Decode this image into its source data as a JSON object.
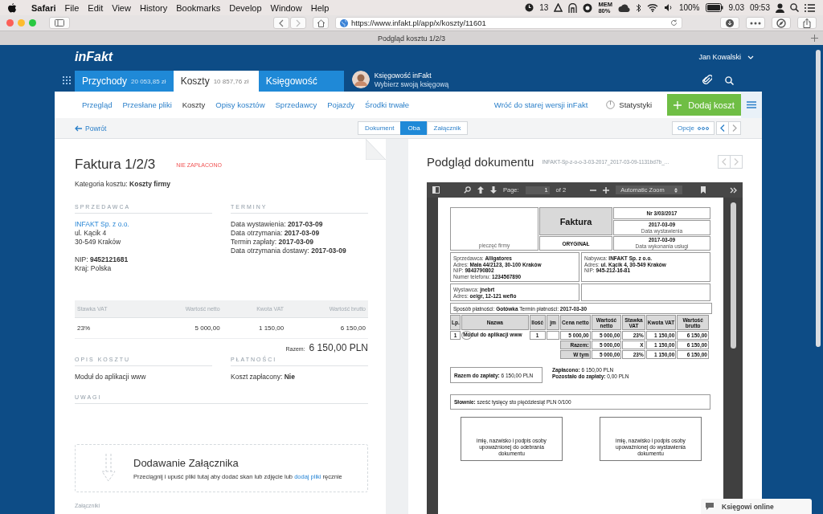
{
  "menubar": {
    "app": "Safari",
    "menus": [
      "File",
      "Edit",
      "View",
      "History",
      "Bookmarks",
      "Develop",
      "Window",
      "Help"
    ],
    "notifications": "13",
    "memory": [
      "MEM",
      "80%"
    ],
    "battery": "100%",
    "date": "9.03",
    "time": "09:53"
  },
  "browser": {
    "url": "https://www.infakt.pl/app/x/koszty/11601",
    "tab_title": "Podgląd kosztu 1/2/3"
  },
  "header": {
    "logo": "inFakt",
    "user": "Jan Kowalski",
    "tabs": [
      {
        "label": "Przychody",
        "amount": "20 053,85 zł",
        "selected": false
      },
      {
        "label": "Koszty",
        "amount": "10 857,76 zł",
        "selected": true
      },
      {
        "label": "Księgowość",
        "selected": false
      }
    ],
    "accountant": {
      "name": "Księgowość inFakt",
      "action": "Wybierz swoją księgową"
    }
  },
  "subnav": {
    "links": [
      {
        "label": "Przegląd",
        "selected": false
      },
      {
        "label": "Przesłane pliki",
        "selected": false
      },
      {
        "label": "Koszty",
        "selected": true
      },
      {
        "label": "Opisy kosztów",
        "selected": false
      },
      {
        "label": "Sprzedawcy",
        "selected": false
      },
      {
        "label": "Pojazdy",
        "selected": false
      },
      {
        "label": "Środki trwałe",
        "selected": false
      }
    ],
    "old_version": "Wróć do starej wersji inFakt",
    "stats": "Statystyki",
    "add_button": "Dodaj koszt"
  },
  "toolbar": {
    "back": "Powrót",
    "views": [
      {
        "label": "Dokument",
        "selected": false
      },
      {
        "label": "Oba",
        "selected": true
      },
      {
        "label": "Załącznik",
        "selected": false
      }
    ],
    "options": "Opcje"
  },
  "invoice": {
    "title": "Faktura 1/2/3",
    "status": "NIE ZAPŁACONO",
    "category_label": "Kategoria kosztu:",
    "category": "Koszty firmy",
    "seller": {
      "heading": "SPRZEDAWCA",
      "name": "INFAKT Sp. z o.o.",
      "street": "ul. Kącik 4",
      "city": "30-549 Kraków",
      "nip_label": "NIP:",
      "nip": "9452121681",
      "country": "Kraj: Polska"
    },
    "terms": {
      "heading": "TERMINY",
      "items": [
        {
          "label": "Data wystawienia:",
          "value": "2017-03-09"
        },
        {
          "label": "Data otrzymania:",
          "value": "2017-03-09"
        },
        {
          "label": "Termin zapłaty:",
          "value": "2017-03-09"
        },
        {
          "label": "Data otrzymania dostawy:",
          "value": "2017-03-09"
        }
      ]
    },
    "vat_table": {
      "columns": [
        "Stawka VAT",
        "Wartość netto",
        "Kwota VAT",
        "Wartość brutto"
      ],
      "rows": [
        [
          "23%",
          "5 000,00",
          "1 150,00",
          "6 150,00"
        ]
      ]
    },
    "total_label": "Razem:",
    "total": "6 150,00 PLN",
    "description": {
      "heading": "OPIS KOSZTU",
      "text": "Moduł do aplikacji www"
    },
    "payments": {
      "heading": "PŁATNOŚCI",
      "label": "Koszt zapłacony:",
      "value": "Nie"
    },
    "notes_heading": "UWAGI",
    "attachment": {
      "title": "Dodawanie Załącznika",
      "text_before": "Przeciągnij i upuść pliki tutaj aby dodać skan lub zdjęcie lub",
      "link": "dodaj pliki",
      "text_after": "ręcznie"
    },
    "attachments_heading": "Załączniki"
  },
  "preview": {
    "title": "Podgląd dokumentu",
    "filename": "INFAKT-Sp-z-o-o-3-03-2017_2017-03-09-1131bd7b_...",
    "pdf": {
      "page_label": "Page:",
      "page": "1",
      "page_count": "of 2",
      "zoom": "Automatic Zoom",
      "document": {
        "logo_caption": "pieczęć firmy",
        "title": "Faktura",
        "copy": "ORYGINAŁ",
        "number": "Nr 3/03/2017",
        "issue_date": "2017-03-09",
        "issue_caption": "Data wystawienia",
        "service_date": "2017-03-09",
        "service_caption": "Data wykonania usługi",
        "seller": [
          {
            "label": "Sprzedawca:",
            "value": "Alligatores"
          },
          {
            "label": "Adres:",
            "value": "Mała 44/2123, 30-100 Kraków"
          },
          {
            "label": "NIP:",
            "value": "9843790802"
          },
          {
            "label": "Numer telefonu:",
            "value": "1234567890"
          }
        ],
        "buyer": [
          {
            "label": "Nabywca:",
            "value": "INFAKT Sp. z o.o."
          },
          {
            "label": "Adres:",
            "value": "ul. Kącik 4, 30-549 Kraków"
          },
          {
            "label": "NIP:",
            "value": "945-212-16-81"
          }
        ],
        "issuer": [
          {
            "label": "Wystawca:",
            "value": "jnebrt"
          },
          {
            "label": "Adres:",
            "value": "oeigr, 12-121 wefio"
          }
        ],
        "payment": [
          {
            "label": "Sposób płatności:",
            "value": "Gotówka"
          },
          {
            "label": "Termin płatności:",
            "value": "2017-03-30"
          }
        ],
        "columns": [
          "Lp.",
          "Nazwa",
          "Ilość",
          "jm",
          "Cena netto",
          "Wartość netto",
          "Stawka VAT",
          "Kwota VAT",
          "Wartość brutto"
        ],
        "rows": [
          [
            "1",
            "Moduł do aplikacji www",
            "1",
            null,
            "5 000,00",
            "5 000,00",
            "23%",
            "1 150,00",
            "6 150,00"
          ]
        ],
        "summary": [
          {
            "label": "Razem:",
            "values": [
              "5 000,00",
              "X",
              "1 150,00",
              "6 150,00"
            ]
          },
          {
            "label": "W tym",
            "values": [
              "5 000,00",
              "23%",
              "1 150,00",
              "6 150,00"
            ]
          }
        ],
        "due": {
          "label": "Razem do zapłaty:",
          "value": "6 150,00 PLN"
        },
        "paid": [
          {
            "label": "Zapłacono:",
            "value": "6 150,00 PLN"
          },
          {
            "label": "Pozostało do zapłaty:",
            "value": "0,00 PLN"
          }
        ],
        "words": {
          "label": "Słownie:",
          "value": "sześć tysięcy sto pięćdziesiąt PLN 0/100"
        },
        "signatures": [
          "imię, nazwisko i podpis osoby upoważnionej do odebrania dokumentu",
          "imię, nazwisko i podpis osoby upoważnionej do wystawienia dokumentu"
        ]
      }
    }
  },
  "chat": {
    "label": "Księgowi online"
  }
}
